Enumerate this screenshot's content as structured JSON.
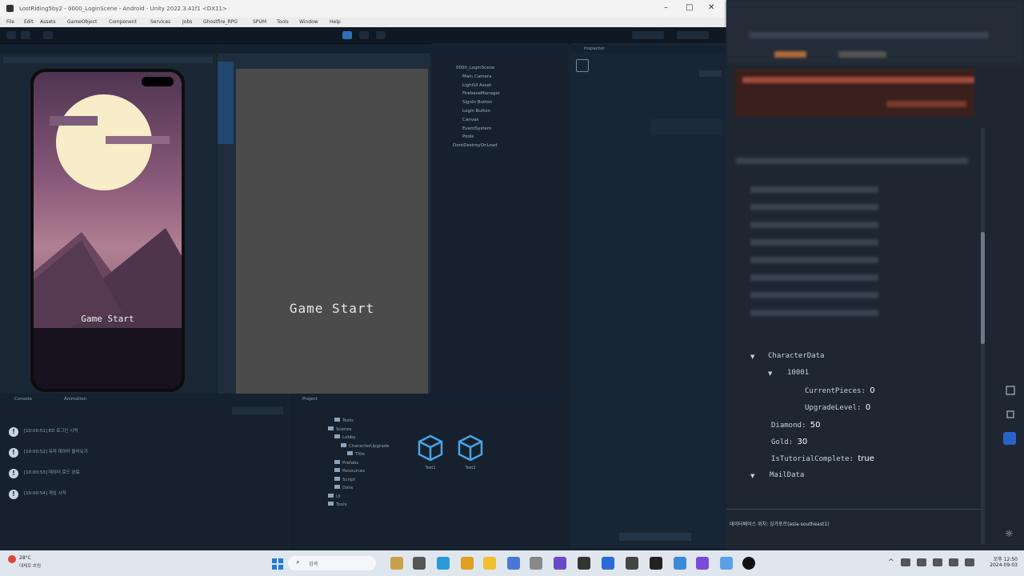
{
  "window": {
    "title": "LostRiding5by2 - 0000_LoginScene - Android - Unity 2022.3.41f1 <DX11>"
  },
  "menu": [
    "File",
    "Edit",
    "Assets",
    "GameObject",
    "Component",
    "Services",
    "Jobs",
    "Ghostfire_RPG",
    "SPUM",
    "Tools",
    "Window",
    "Help"
  ],
  "scene_view": {
    "button_label": "Game Start"
  },
  "game_view": {
    "button_label": "Game Start"
  },
  "hierarchy": {
    "items": [
      "0000_LoginScene",
      "Main Camera",
      "LightUI Asset",
      "FirebaseManager",
      "SignIn Button",
      "Login Button",
      "Canvas",
      "EventSystem",
      "Pools",
      "DontDestroyOnLoad"
    ]
  },
  "console": {
    "tabs": [
      "Console",
      "Animation"
    ],
    "entries": [
      "[10:00:51] ED 로그인 시작",
      "[10:00:52] 유저 데이터 불러오기",
      "[10:00:53] 데이터 로드 완료",
      "[10:00:54] 게임 시작"
    ]
  },
  "project": {
    "tab": "Project",
    "folders": [
      "Tests",
      "Scenes",
      "Lobby",
      "CharacterUpgrade",
      "Title",
      "Prefabs",
      "Resources",
      "Script",
      "Data",
      "UI",
      "Tools"
    ],
    "assets": [
      {
        "name": "Test1",
        "icon": "prefab-icon"
      },
      {
        "name": "Test2",
        "icon": "prefab-icon"
      }
    ]
  },
  "inspector": {
    "tab": "Inspector"
  },
  "firebase_data": {
    "character_data_label": "CharacterData",
    "character_id": "10001",
    "fields": [
      {
        "key": "CurrentPieces",
        "value": "0"
      },
      {
        "key": "UpgradeLevel",
        "value": "0"
      }
    ],
    "diamond_key": "Diamond",
    "diamond_value": "50",
    "gold_key": "Gold",
    "gold_value": "30",
    "tutorial_key": "IsTutorialComplete",
    "tutorial_value": "true",
    "mail_label": "MailData",
    "footer_text": "데이터베이스 위치: 싱가포르(asia-southeast1)"
  },
  "taskbar": {
    "weather_temp": "28°C",
    "weather_text": "대체로 흐림",
    "search_placeholder": "검색",
    "time": "오후 12:50",
    "date": "2024-09-03"
  }
}
